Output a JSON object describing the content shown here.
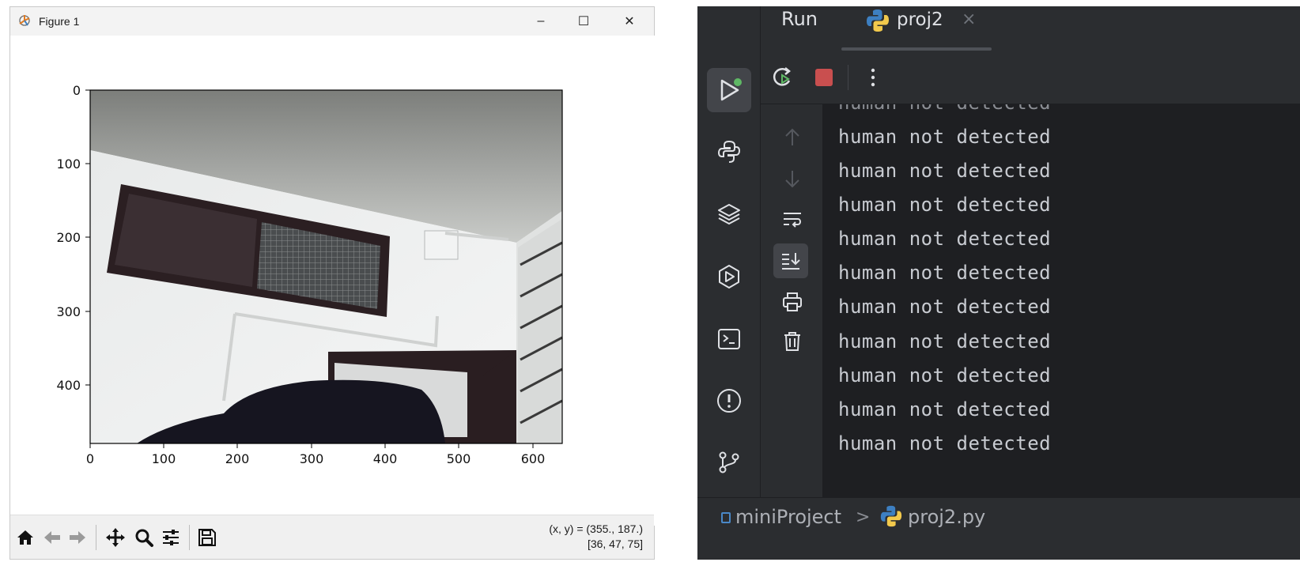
{
  "figure_window": {
    "title": "Figure 1",
    "controls": {
      "minimize": "–",
      "maximize": "☐",
      "close": "✕"
    }
  },
  "chart_data": {
    "type": "image",
    "x_ticks": [
      0,
      100,
      200,
      300,
      400,
      500,
      600
    ],
    "y_ticks": [
      0,
      100,
      200,
      300,
      400
    ],
    "xlim": [
      0,
      640
    ],
    "ylim": [
      480,
      0
    ],
    "image_description": "webcam frame of a room: white ceiling and walls, dark window, partial door, dark object in foreground"
  },
  "figure_toolbar": {
    "buttons": [
      "home-icon",
      "back-icon",
      "forward-icon",
      "pan-icon",
      "zoom-icon",
      "configure-subplots-icon",
      "save-icon"
    ],
    "coord_line1": "(x, y) = (355., 187.)",
    "coord_line2": "[36, 47, 75]"
  },
  "ide": {
    "header": {
      "title": "Run",
      "tab_label": "proj2",
      "tab_close": "×"
    },
    "console_lines": [
      "human not detected",
      "human not detected",
      "human not detected",
      "human not detected",
      "human not detected",
      "human not detected",
      "human not detected",
      "human not detected",
      "human not detected",
      "human not detected",
      "human not detected"
    ],
    "breadcrumb": {
      "module": "miniProject",
      "separator": ">",
      "file": "proj2.py"
    },
    "colors": {
      "background": "#2b2d30",
      "console": "#1e1f22",
      "stop": "#c94f4f",
      "run_badge": "#5fb865",
      "python_blue": "#3d7fc1",
      "python_yellow": "#f2c94c"
    }
  }
}
